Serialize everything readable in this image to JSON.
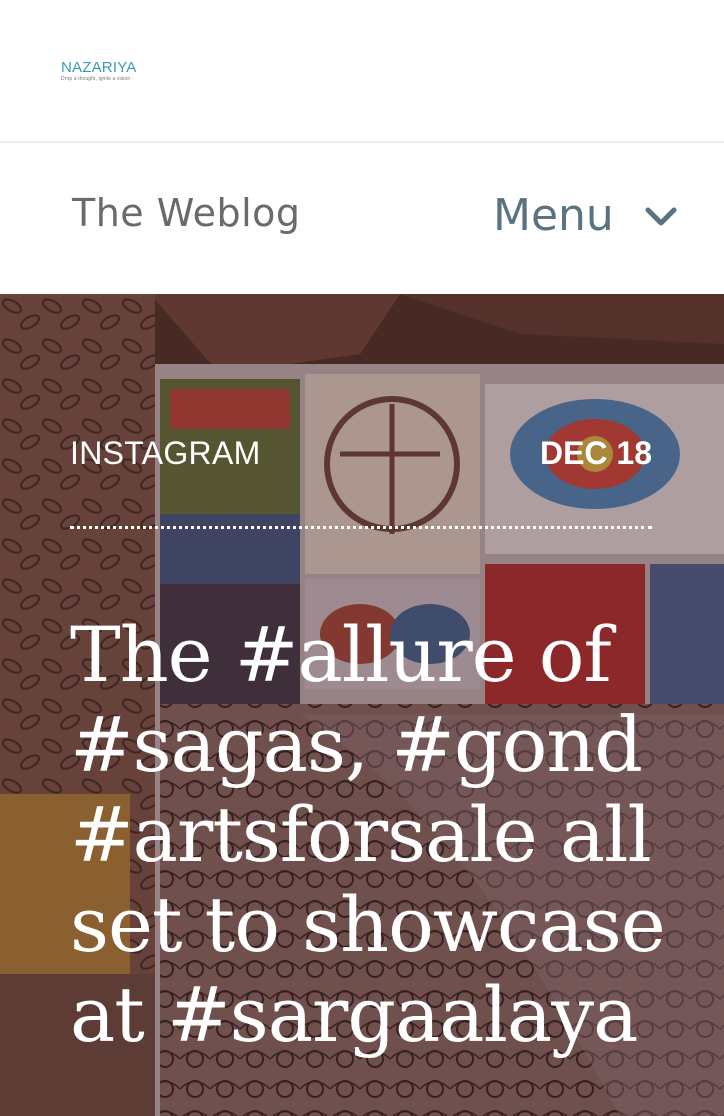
{
  "header": {
    "logo_name": "NAZARIYA",
    "logo_tagline": "Drop a thought, ignite a vision",
    "blog_title": "The Weblog",
    "menu_label": "Menu"
  },
  "post": {
    "category": "INSTAGRAM",
    "date": "DEC 18",
    "title": "The #allure of #sagas, #gond #artsforsale all set to showcase at #sargaalaya"
  },
  "colors": {
    "logo": "#3a9ab4",
    "menu": "#5b7280",
    "title_text": "#ffffff"
  },
  "icons": {
    "menu": "chevron-down-icon"
  }
}
